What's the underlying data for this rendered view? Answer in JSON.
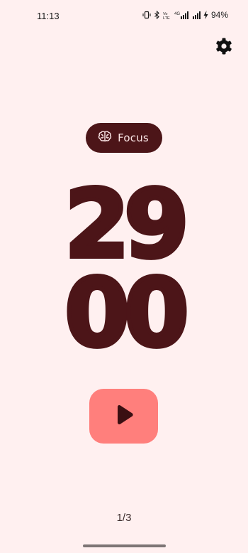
{
  "status_bar": {
    "time": "11:13",
    "battery": "94%",
    "icons": [
      "vibrate-icon",
      "bluetooth-icon",
      "volte-icon",
      "signal-4g-icon",
      "signal-bars-icon",
      "battery-charging-icon"
    ]
  },
  "settings": {
    "icon": "gear-icon"
  },
  "mode": {
    "label": "Focus",
    "icon": "brain-icon"
  },
  "timer": {
    "minutes": "29",
    "seconds": "00"
  },
  "controls": {
    "play_icon": "play-icon"
  },
  "session": {
    "counter": "1/3"
  },
  "colors": {
    "background": "#FFF0F0",
    "primary": "#4C1518",
    "accent": "#FF7F7C",
    "chip_text": "#FBE6E6"
  }
}
